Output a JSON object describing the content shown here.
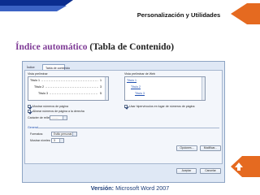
{
  "header": {
    "title": "Personalización y Utilidades"
  },
  "heading": {
    "accent": "Índice automático",
    "rest": "(Tabla de Contenido)"
  },
  "dialog": {
    "tabs": [
      "Índice",
      "Tabla de contenido"
    ],
    "print_preview_label": "Vista preliminar",
    "web_preview_label": "Vista preliminar de Web",
    "print_entries": [
      {
        "text": "Título 1",
        "page": "1"
      },
      {
        "text": "Título 2",
        "page": "3"
      },
      {
        "text": "Título 3",
        "page": "5"
      }
    ],
    "web_entries": [
      "Título 1",
      "Título 2",
      "Título 3"
    ],
    "options": {
      "show_page_numbers": "Mostrar números de página",
      "align_right": "Alinear números de página a la derecha",
      "use_hyperlinks": "Usar hipervínculos en lugar de números de página"
    },
    "tab_leader": {
      "label": "Carácter de relleno:",
      "value": "........"
    },
    "general": {
      "title": "General",
      "formats_label": "Formatos:",
      "formats_value": "Estilo personal",
      "levels_label": "Mostrar niveles:",
      "levels_value": "3"
    },
    "buttons": {
      "options": "Opciones...",
      "modify": "Modificar...",
      "accept": "Aceptar",
      "cancel": "Cancelar"
    }
  },
  "footer": {
    "label": "Versión:",
    "value": "Microsoft Word 2007"
  },
  "colors": {
    "accent": "#7f3b96",
    "header_bar": "#0b2d8f",
    "arrow": "#e56a20"
  }
}
